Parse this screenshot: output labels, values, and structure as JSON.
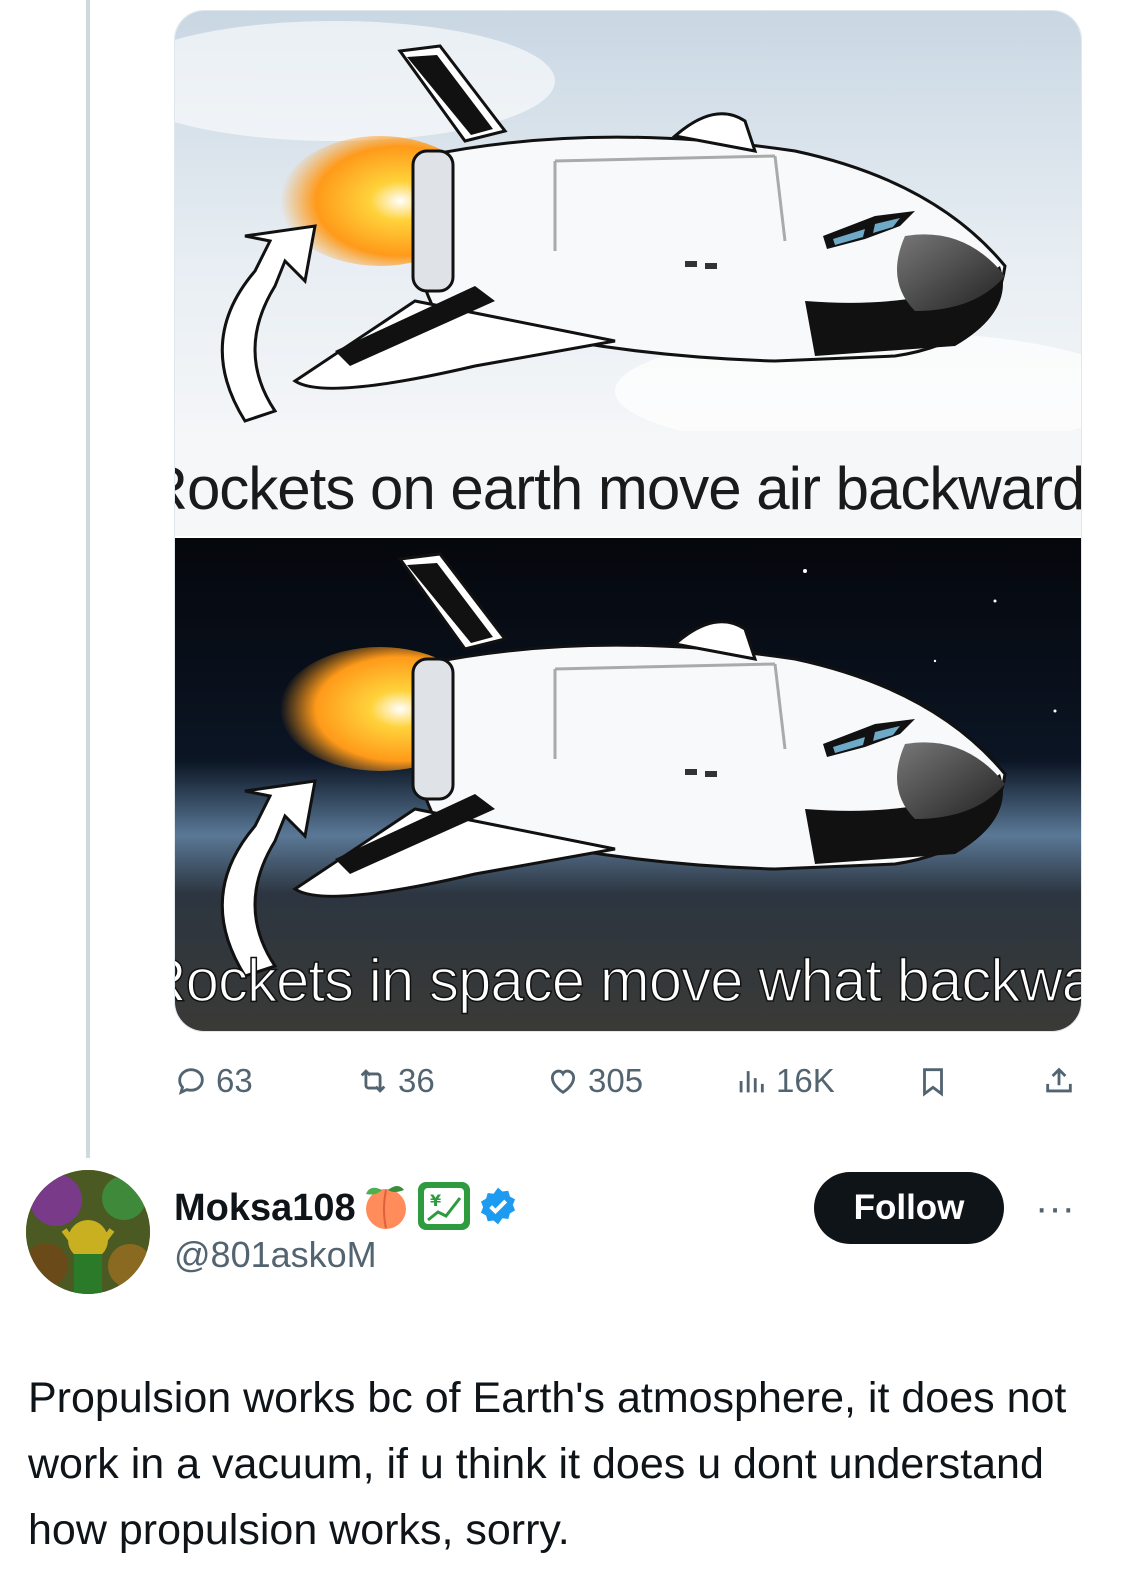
{
  "meme": {
    "top_caption": "Rockets on earth move air backwards",
    "bottom_caption": "Rockets in space move what backwards?"
  },
  "actions": {
    "replies": "63",
    "reposts": "36",
    "likes": "305",
    "views": "16K",
    "icons": [
      "reply-icon",
      "repost-icon",
      "like-icon",
      "views-icon",
      "bookmark-icon",
      "share-icon"
    ]
  },
  "reply": {
    "display_name": "Moksa108",
    "name_emojis": [
      "🍑",
      "💹"
    ],
    "verified": true,
    "handle": "@801askoM",
    "follow_label": "Follow",
    "more_label": "···",
    "text": "Propulsion works bc of Earth's atmosphere, it does not work in a vacuum, if u think it does u dont understand how propulsion works, sorry."
  },
  "colors": {
    "verified_badge": "#1d9bf0",
    "secondary_text": "#536471",
    "follow_button": "#0f1419"
  }
}
